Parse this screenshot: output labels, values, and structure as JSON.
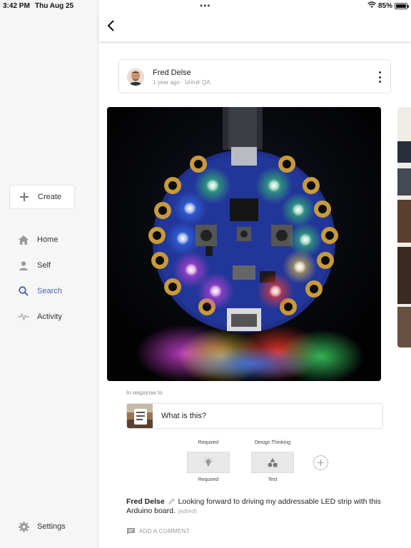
{
  "status_bar": {
    "time": "3:42 PM",
    "date": "Thu Aug 25",
    "dots": "•••",
    "battery": "85%",
    "battery_level": 0.85
  },
  "sidebar": {
    "create_label": "Create",
    "items": [
      {
        "label": "Home",
        "icon": "home-icon"
      },
      {
        "label": "Self",
        "icon": "person-icon"
      },
      {
        "label": "Search",
        "icon": "search-icon",
        "active": true
      },
      {
        "label": "Activity",
        "icon": "activity-icon"
      }
    ],
    "settings_label": "Settings"
  },
  "post": {
    "author": "Fred Delse",
    "time_ago": "1 year ago",
    "group": "Unrulr QA",
    "response_label": "In response to",
    "response_title": "What is this?",
    "tags": [
      {
        "header": "Required",
        "footer": "Required",
        "icon": "lightbulb-icon"
      },
      {
        "header": "Design Thinking",
        "footer": "Test",
        "icon": "shapes-icon"
      }
    ],
    "caption_author": "Fred Delse",
    "caption_text": "Looking forward to driving my addressable LED strip with this Arduino board.",
    "edited": "(edited)",
    "add_comment": "ADD A COMMENT"
  },
  "colors": {
    "accent": "#4a5ea8",
    "sidebar_bg": "#f6f6f6"
  }
}
